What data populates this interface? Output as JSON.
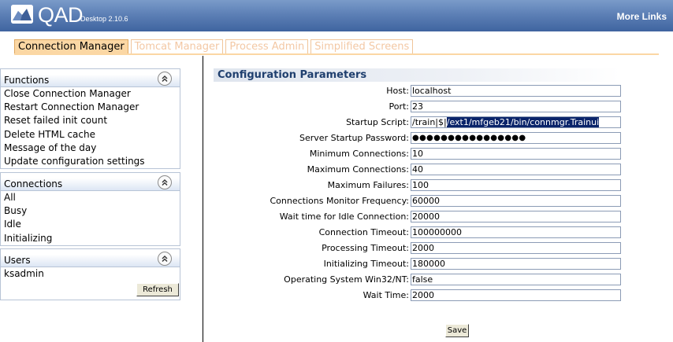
{
  "header": {
    "logo_text": "QAD",
    "version": "Desktop 2.10.6",
    "more_links": "More Links",
    "logo_icon": "qad-logo-icon"
  },
  "tabs": [
    {
      "label": "Connection Manager",
      "active": true
    },
    {
      "label": "Tomcat Manager",
      "active": false
    },
    {
      "label": "Process Admin",
      "active": false
    },
    {
      "label": "Simplified Screens",
      "active": false
    }
  ],
  "sidebar": {
    "functions": {
      "title": "Functions",
      "items": [
        "Close Connection Manager",
        "Restart Connection Manager",
        "Reset failed init count",
        "Delete HTML cache",
        "Message of the day",
        "Update configuration settings"
      ]
    },
    "connections": {
      "title": "Connections",
      "items": [
        "All",
        "Busy",
        "Idle",
        "Initializing"
      ]
    },
    "users": {
      "title": "Users",
      "items": [
        "ksadmin"
      ]
    },
    "refresh_label": "Refresh"
  },
  "config": {
    "title": "Configuration Parameters",
    "rows": [
      {
        "label": "Host:",
        "value": "localhost"
      },
      {
        "label": "Port:",
        "value": "23"
      },
      {
        "label": "Startup Script:",
        "value_plain": "/train|$|",
        "value_selected": "/ext1/mfgeb21/bin/connmgr.Trainui"
      },
      {
        "label": "Server Startup Password:",
        "value": "●●●●●●●●●●●●●●●●"
      },
      {
        "label": "Minimum Connections:",
        "value": "10"
      },
      {
        "label": "Maximum Connections:",
        "value": "40"
      },
      {
        "label": "Maximum Failures:",
        "value": "100"
      },
      {
        "label": "Connections Monitor Frequency:",
        "value": "60000"
      },
      {
        "label": "Wait time for Idle Connection:",
        "value": "20000"
      },
      {
        "label": "Connection Timeout:",
        "value": "100000000"
      },
      {
        "label": "Processing Timeout:",
        "value": "2000"
      },
      {
        "label": "Initializing Timeout:",
        "value": "180000"
      },
      {
        "label": "Operating System Win32/NT:",
        "value": "false"
      },
      {
        "label": "Wait Time:",
        "value": "2000"
      }
    ],
    "save_label": "Save"
  },
  "colors": {
    "header": "#5d80b6",
    "tab_active": "#fbd7a4",
    "selection": "#0a246a"
  }
}
